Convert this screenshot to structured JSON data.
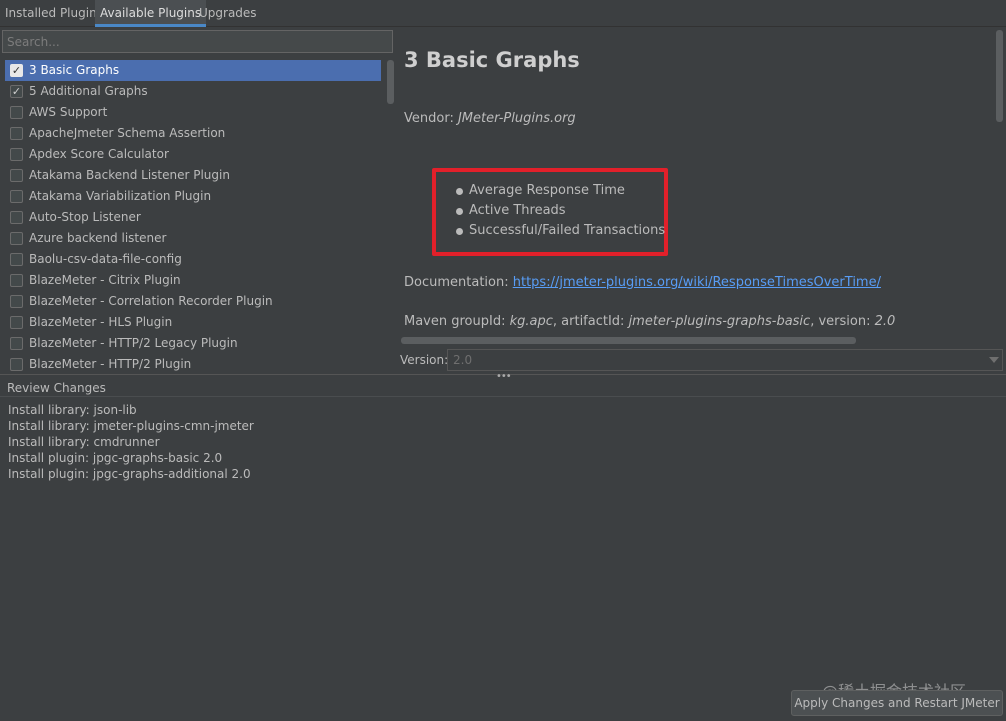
{
  "tabs": [
    {
      "label": "Installed Plugins",
      "active": false
    },
    {
      "label": "Available Plugins",
      "active": true
    },
    {
      "label": "Upgrades",
      "active": false
    }
  ],
  "search": {
    "placeholder": "Search...",
    "value": ""
  },
  "plugins": [
    {
      "label": "3 Basic Graphs",
      "checked": true,
      "selected": true
    },
    {
      "label": "5 Additional Graphs",
      "checked": true,
      "selected": false
    },
    {
      "label": "AWS Support",
      "checked": false,
      "selected": false
    },
    {
      "label": "ApacheJmeter Schema Assertion",
      "checked": false,
      "selected": false
    },
    {
      "label": "Apdex Score Calculator",
      "checked": false,
      "selected": false
    },
    {
      "label": "Atakama Backend Listener Plugin",
      "checked": false,
      "selected": false
    },
    {
      "label": "Atakama Variabilization Plugin",
      "checked": false,
      "selected": false
    },
    {
      "label": "Auto-Stop Listener",
      "checked": false,
      "selected": false
    },
    {
      "label": "Azure backend listener",
      "checked": false,
      "selected": false
    },
    {
      "label": "Baolu-csv-data-file-config",
      "checked": false,
      "selected": false
    },
    {
      "label": "BlazeMeter - Citrix Plugin",
      "checked": false,
      "selected": false
    },
    {
      "label": "BlazeMeter - Correlation Recorder Plugin",
      "checked": false,
      "selected": false
    },
    {
      "label": "BlazeMeter - HLS Plugin",
      "checked": false,
      "selected": false
    },
    {
      "label": "BlazeMeter - HTTP/2 Legacy Plugin",
      "checked": false,
      "selected": false
    },
    {
      "label": "BlazeMeter - HTTP/2 Plugin",
      "checked": false,
      "selected": false
    }
  ],
  "detail": {
    "title": "3 Basic Graphs",
    "vendor_label": "Vendor: ",
    "vendor_value": "JMeter-Plugins.org",
    "features": [
      "Average Response Time",
      "Active Threads",
      "Successful/Failed Transactions"
    ],
    "documentation_label": "Documentation: ",
    "documentation_url": "https://jmeter-plugins.org/wiki/ResponseTimesOverTime/",
    "maven": {
      "groupid_label": "Maven groupId: ",
      "groupid_value": "kg.apc",
      "artifactid_label": ", artifactId: ",
      "artifactid_value": "jmeter-plugins-graphs-basic",
      "version_label": ", version: ",
      "version_value": "2.0"
    },
    "version_select_label": "Version:",
    "version_select_value": "2.0"
  },
  "review": {
    "header": "Review Changes",
    "items": [
      "Install library: json-lib",
      "Install library: jmeter-plugins-cmn-jmeter",
      "Install library: cmdrunner",
      "Install plugin: jpgc-graphs-basic 2.0",
      "Install plugin: jpgc-graphs-additional 2.0"
    ]
  },
  "footer": {
    "apply_label": "Apply Changes and Restart JMeter",
    "watermark": "@稀土掘金技术社区"
  },
  "colors": {
    "background": "#3c3f41",
    "selection": "#4b6eaf",
    "link": "#589df6",
    "highlight_box": "#e2202a"
  }
}
